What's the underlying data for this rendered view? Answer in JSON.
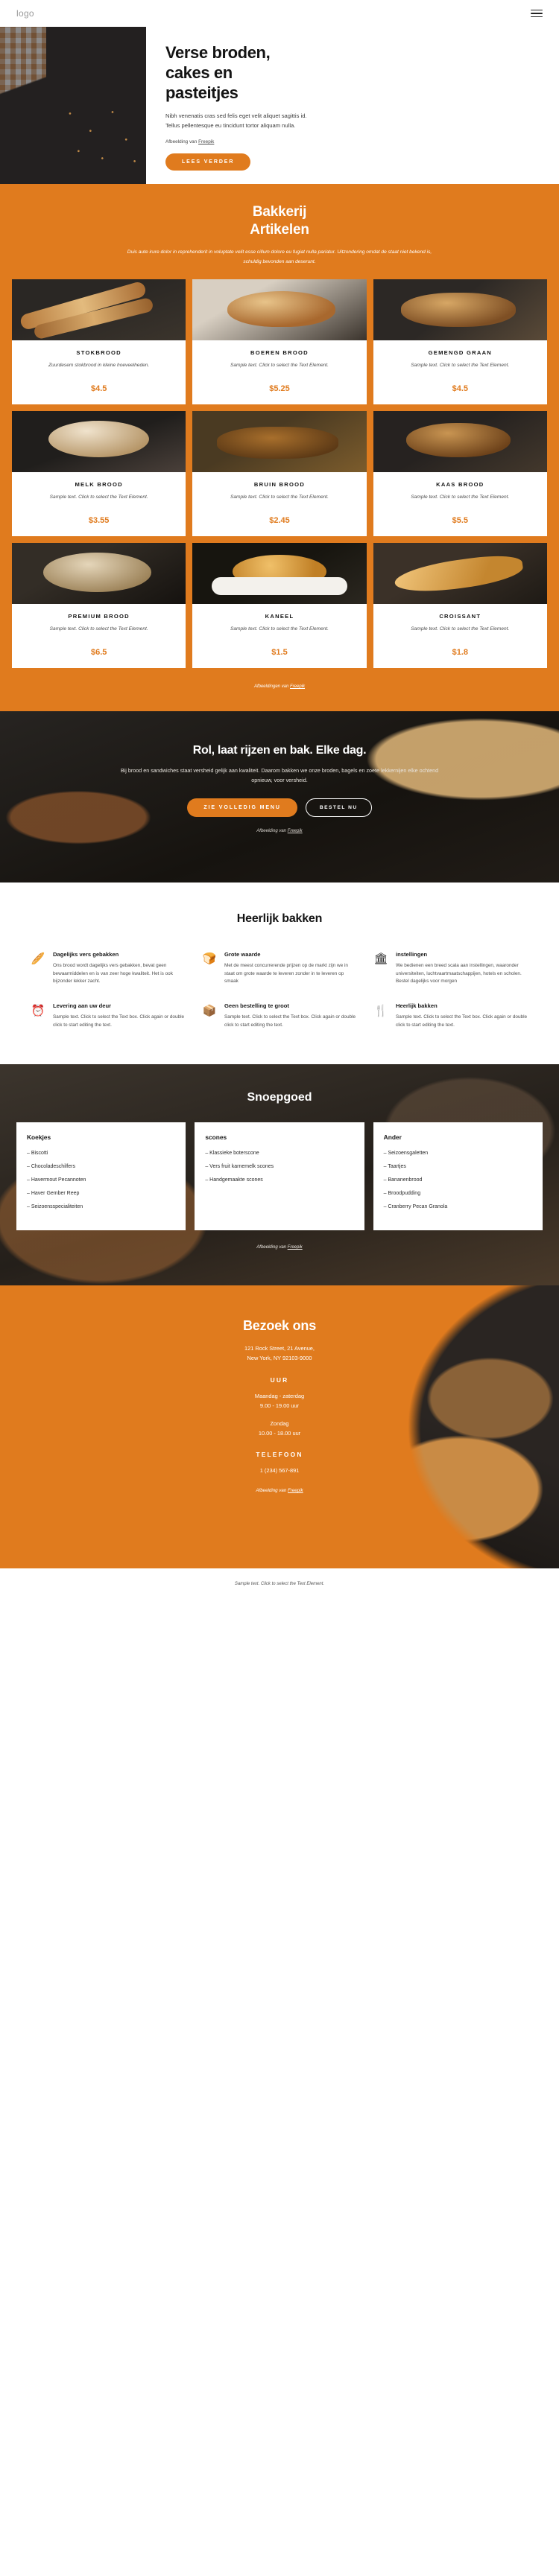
{
  "colors": {
    "accent": "#e07b1e",
    "dark": "#1a1a1a",
    "white": "#ffffff"
  },
  "header": {
    "logo": "logo",
    "menu_icon": "hamburger-icon"
  },
  "hero": {
    "title_line1": "Verse broden,",
    "title_line2": "cakes en",
    "title_line3": "pasteitjes",
    "paragraph": "Nibh venenatis cras sed felis eget velit aliquet sagittis id. Tellus pellentesque eu tincidunt tortor aliquam nulla.",
    "credit_prefix": "Afbeelding van ",
    "credit_link": "Freepik",
    "button": "LEES VERDER"
  },
  "products": {
    "title_line1": "Bakkerij",
    "title_line2": "Artikelen",
    "subtitle": "Duis aute irure dolor in reprehenderit in voluptate velit esse cillum dolore eu fugiat nulla pariatur. Uitzondering omdat de staat niet bekend is, schuldig bevonden aan deserunt.",
    "credit_prefix": "Afbeeldingen van ",
    "credit_link": "Freepik",
    "items": [
      {
        "name": "STOKBROOD",
        "desc": "Zuurdesem stokbrood in kleine hoeveelheden.",
        "price": "$4.5",
        "img": "p1"
      },
      {
        "name": "BOEREN BROOD",
        "desc": "Sample text. Click to select the Text Element.",
        "price": "$5.25",
        "img": "p2"
      },
      {
        "name": "GEMENGD GRAAN",
        "desc": "Sample text. Click to select the Text Element.",
        "price": "$4.5",
        "img": "p3"
      },
      {
        "name": "MELK BROOD",
        "desc": "Sample text. Click to select the Text Element.",
        "price": "$3.55",
        "img": "p4"
      },
      {
        "name": "BRUIN BROOD",
        "desc": "Sample text. Click to select the Text Element.",
        "price": "$2.45",
        "img": "p5"
      },
      {
        "name": "KAAS BROOD",
        "desc": "Sample text. Click to select the Text Element.",
        "price": "$5.5",
        "img": "p6"
      },
      {
        "name": "PREMIUM BROOD",
        "desc": "Sample text. Click to select the Text Element.",
        "price": "$6.5",
        "img": "p7"
      },
      {
        "name": "KANEEL",
        "desc": "Sample text. Click to select the Text Element.",
        "price": "$1.5",
        "img": "p8"
      },
      {
        "name": "CROISSANT",
        "desc": "Sample text. Click to select the Text Element.",
        "price": "$1.8",
        "img": "p9"
      }
    ]
  },
  "cta": {
    "title": "Rol, laat rijzen en bak. Elke dag.",
    "paragraph": "Bij brood en sandwiches staat versheid gelijk aan kwaliteit. Daarom bakken we onze broden, bagels en zoete lekkernijen elke ochtend opnieuw, voor versheid.",
    "button_primary": "ZIE VOLLEDIG MENU",
    "button_secondary": "BESTEL NU",
    "credit_prefix": "Afbeelding van ",
    "credit_link": "Freepik"
  },
  "features": {
    "title": "Heerlijk bakken",
    "items": [
      {
        "icon": "bread-icon",
        "glyph": "🥖",
        "name": "Dagelijks vers gebakken",
        "desc": "Ons brood wordt dagelijks vers gebakken, bevat geen bewaarmiddelen en is van zeer hoge kwaliteit. Het is ook bijzonder lekker zacht."
      },
      {
        "icon": "steam-bun-icon",
        "glyph": "🍞",
        "name": "Grote waarde",
        "desc": "Met de meest concurrerende prijzen op de markt zijn we in staat om grote waarde te leveren zonder in te leveren op smaak"
      },
      {
        "icon": "building-icon",
        "glyph": "🏛",
        "name": "instellingen",
        "desc": "We bedienen een breed scala aan instellingen, waaronder universiteiten, lucht­vaartmaatschappijen, hotels en scholen. Bestel dagelijks voor morgen"
      },
      {
        "icon": "clock-icon",
        "glyph": "⏰",
        "name": "Levering aan uw deur",
        "desc": "Sample text. Click to select the Text box. Click again or double click to start editing the text."
      },
      {
        "icon": "box-icon",
        "glyph": "📦",
        "name": "Geen bestelling te groot",
        "desc": "Sample text. Click to select the Text box. Click again or double click to start editing the text."
      },
      {
        "icon": "cutlery-icon",
        "glyph": "🍴",
        "name": "Heerlijk bakken",
        "desc": "Sample text. Click to select the Text box. Click again or double click to start editing the text."
      }
    ]
  },
  "sweets": {
    "title": "Snoepgoed",
    "credit_prefix": "Afbeelding van ",
    "credit_link": "Freepik",
    "columns": [
      {
        "heading": "Koekjes",
        "items": [
          "– Biscotti",
          "– Chocoladeschilfers",
          "– Havermout Pecannoten",
          "– Haver Gember Reep",
          "– Seizoensspecialiteiten"
        ]
      },
      {
        "heading": "scones",
        "items": [
          "– Klassieke boterscone",
          "– Vers fruit karnemelk scones",
          "– Handgemaakte scones"
        ]
      },
      {
        "heading": "Ander",
        "items": [
          "– Seizoensgaletten",
          "– Taartjes",
          "– Bananenbrood",
          "– Broodpudding",
          "– Cranberry Pecan Granola"
        ]
      }
    ]
  },
  "visit": {
    "title": "Bezoek ons",
    "address_line1": "121 Rock Street, 21 Avenue,",
    "address_line2": "New York, NY 92103-9000",
    "hours_heading": "UUR",
    "hours_weekday_days": "Maandag - zaterdag",
    "hours_weekday_time": "9.00 - 19.00 uur",
    "hours_sunday_days": "Zondag",
    "hours_sunday_time": "10.00 - 18.00 uur",
    "phone_heading": "TELEFOON",
    "phone_number": "1 (234) 567-891",
    "credit_prefix": "Afbeelding van ",
    "credit_link": "Freepik"
  },
  "footer": {
    "text": "Sample text. Click to select the Text Element."
  }
}
